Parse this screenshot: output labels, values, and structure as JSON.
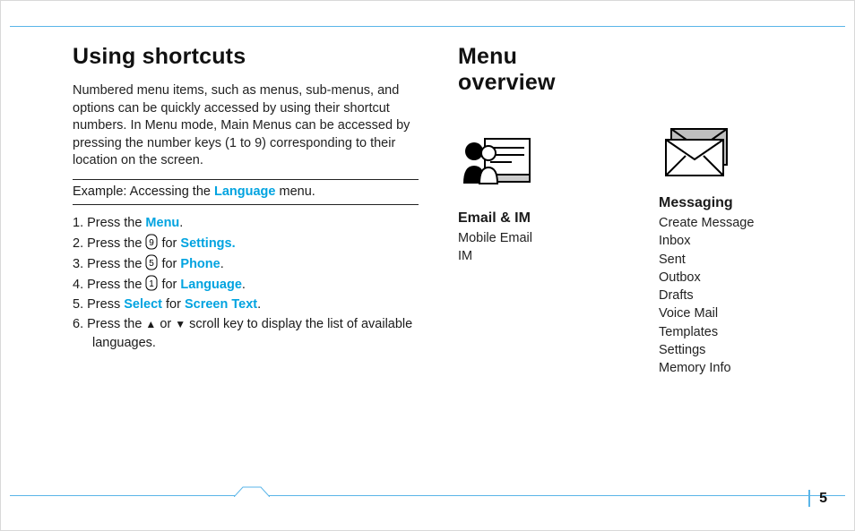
{
  "left": {
    "heading": "Using shortcuts",
    "intro": "Numbered menu items, such as menus, sub-menus, and options can be quickly accessed by using their shortcut numbers. In Menu mode, Main Menus can be accessed by pressing the number keys (1 to 9) corresponding to their location on the screen.",
    "example_prefix": "Example: Accessing the ",
    "example_kw": "Language",
    "example_suffix": " menu.",
    "steps": {
      "s1a": "Press the ",
      "s1k": "Menu",
      "s1b": ".",
      "s2a": "Press the ",
      "s2b": " for ",
      "s2k": "Settings.",
      "s3a": "Press the ",
      "s3b": " for ",
      "s3k": "Phone",
      "s3c": ".",
      "s4a": "Press the ",
      "s4b": " for ",
      "s4k": "Language",
      "s4c": ".",
      "s5a": "Press ",
      "s5k1": "Select",
      "s5b": " for ",
      "s5k2": "Screen Text",
      "s5c": ".",
      "s6a": "Press the ",
      "s6up": "▲",
      "s6or": " or ",
      "s6dn": "▼",
      "s6b": " scroll key to display the list of available languages."
    }
  },
  "right_heading": "Menu overview",
  "menu1": {
    "title": "Email & IM",
    "items": [
      "Mobile Email",
      "IM"
    ]
  },
  "menu2": {
    "title": "Messaging",
    "items": [
      "Create Message",
      "Inbox",
      "Sent",
      "Outbox",
      "Drafts",
      "Voice Mail",
      "Templates",
      "Settings",
      "Memory Info"
    ]
  },
  "page_number": "5"
}
